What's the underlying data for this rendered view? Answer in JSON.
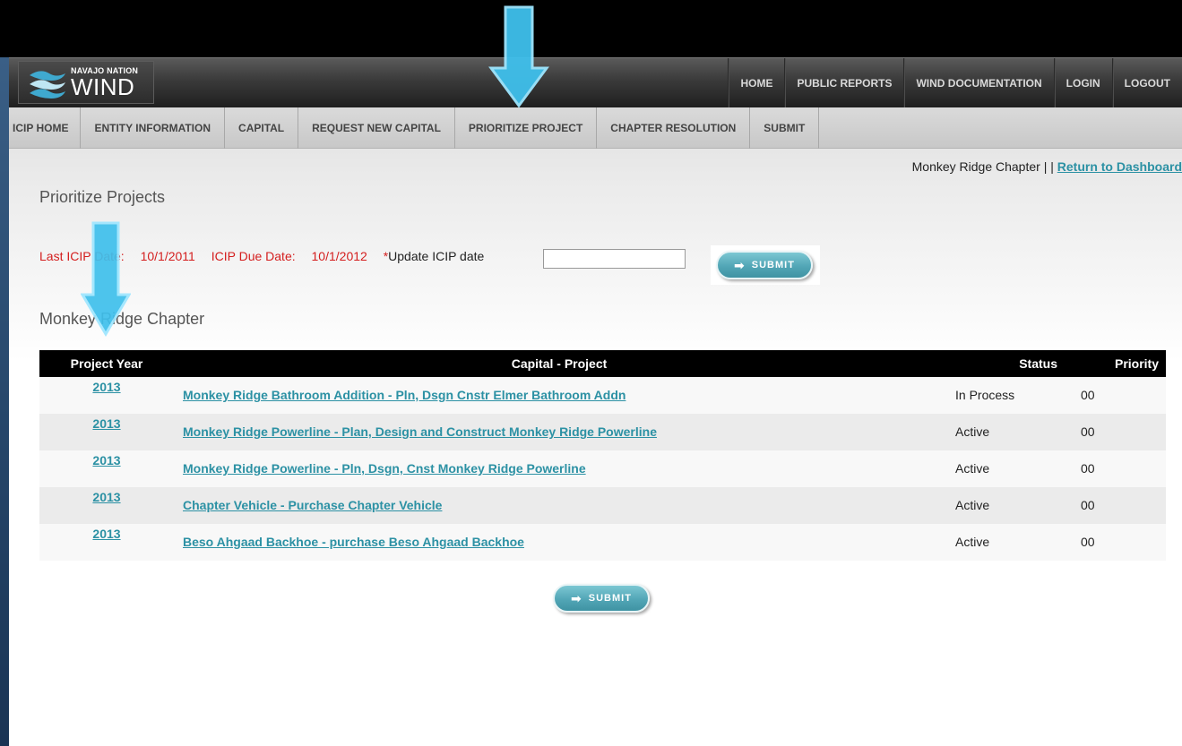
{
  "brand": {
    "top": "NAVAJO NATION",
    "main": "WIND"
  },
  "top_nav": [
    "HOME",
    "PUBLIC REPORTS",
    "WIND DOCUMENTATION",
    "LOGIN",
    "LOGOUT"
  ],
  "sub_nav": [
    "ICIP HOME",
    "ENTITY INFORMATION",
    "CAPITAL",
    "REQUEST NEW CAPITAL",
    "PRIORITIZE PROJECT",
    "CHAPTER RESOLUTION",
    "SUBMIT"
  ],
  "chapter_line": {
    "chapter": "Monkey Ridge Chapter | |",
    "link": "Return to Dashboard"
  },
  "page_title": "Prioritize Projects",
  "dates": {
    "last_label": "Last ICIP Date:",
    "last_value": "10/1/2011",
    "due_label": "ICIP Due Date:",
    "due_value": "10/1/2012",
    "update_star": "*",
    "update_label": "Update ICIP date"
  },
  "update_input_value": "",
  "submit_label": "SUBMIT",
  "section_title": "Monkey Ridge Chapter",
  "table": {
    "headers": [
      "Project Year",
      "Capital - Project",
      "Status",
      "Priority"
    ],
    "rows": [
      {
        "year": "2013",
        "project": "Monkey Ridge Bathroom Addition - Pln, Dsgn Cnstr Elmer Bathroom Addn",
        "status": "In Process",
        "priority": "00"
      },
      {
        "year": "2013",
        "project": "Monkey Ridge Powerline - Plan, Design and Construct Monkey Ridge Powerline",
        "status": "Active",
        "priority": "00"
      },
      {
        "year": "2013",
        "project": "Monkey Ridge Powerline - Pln, Dsgn, Cnst Monkey Ridge Powerline",
        "status": "Active",
        "priority": "00"
      },
      {
        "year": "2013",
        "project": "Chapter Vehicle - Purchase Chapter Vehicle",
        "status": "Active",
        "priority": "00"
      },
      {
        "year": "2013",
        "project": "Beso Ahgaad Backhoe - purchase Beso Ahgaad Backhoe",
        "status": "Active",
        "priority": "00"
      }
    ]
  },
  "colors": {
    "accent": "#2c91a4",
    "alert": "#d41e1e",
    "arrow": "#3fc0ec"
  },
  "icons": {
    "arrow": "down-arrow-icon",
    "submit": "right-arrow-icon"
  }
}
